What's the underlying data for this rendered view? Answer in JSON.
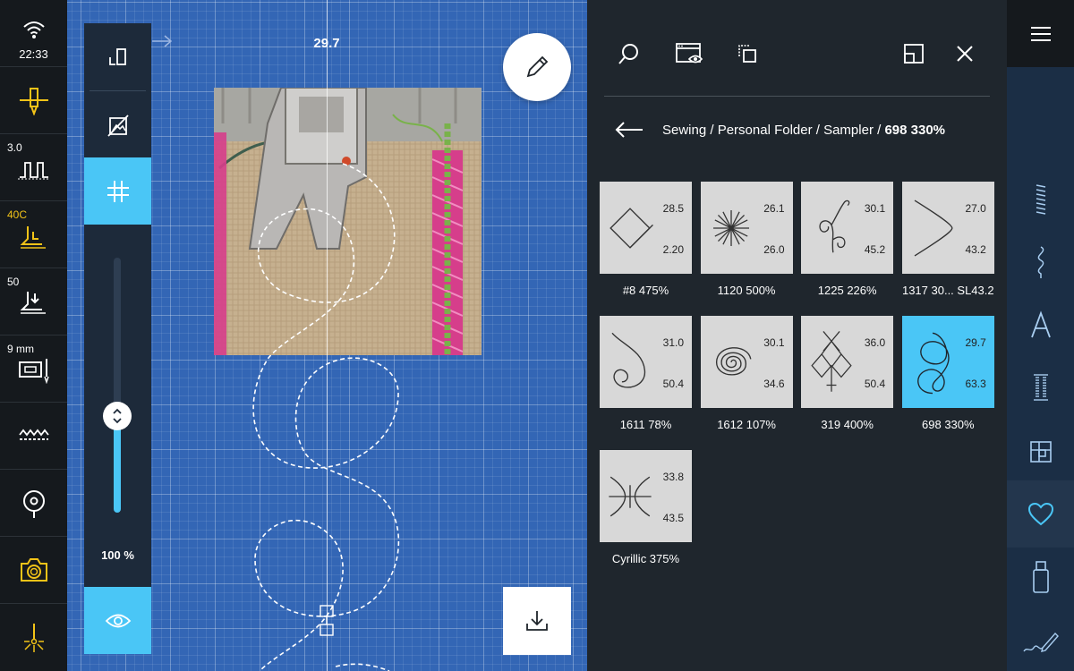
{
  "status": {
    "time": "22:33",
    "stitch_width": "3.0",
    "tension": "40C",
    "presser_foot_pressure": "50",
    "hoop_size": "9 mm"
  },
  "canvas": {
    "measurement": "29.7",
    "zoom_percent": "100 %",
    "zoom_level": 0.38
  },
  "breadcrumb": {
    "path": "Sewing / Personal Folder / Sampler / ",
    "current": "698 330%"
  },
  "stitches": [
    {
      "name": "#8 475%",
      "width": "28.5",
      "height": "2.20",
      "icon": "diamond-loop",
      "selected": false
    },
    {
      "name": "1120 500%",
      "width": "26.1",
      "height": "26.0",
      "icon": "star-burst",
      "selected": false
    },
    {
      "name": "1225 226%",
      "width": "30.1",
      "height": "45.2",
      "icon": "curl-vine",
      "selected": false
    },
    {
      "name": "1317 30... SL43.2",
      "width": "27.0",
      "height": "43.2",
      "icon": "chevron-curve",
      "selected": false
    },
    {
      "name": "1611 78%",
      "width": "31.0",
      "height": "50.4",
      "icon": "hook-spiral",
      "selected": false
    },
    {
      "name": "1612 107%",
      "width": "30.1",
      "height": "34.6",
      "icon": "spiral",
      "selected": false
    },
    {
      "name": "319 400%",
      "width": "36.0",
      "height": "50.4",
      "icon": "diamond-cross",
      "selected": false
    },
    {
      "name": "698 330%",
      "width": "29.7",
      "height": "63.3",
      "icon": "double-loop",
      "selected": true
    },
    {
      "name": "Cyrillic 375%",
      "width": "33.8",
      "height": "43.5",
      "icon": "cross-arc",
      "selected": false
    }
  ],
  "colors": {
    "accent": "#4ac6f6",
    "warning_yellow": "#f2c318",
    "canvas_blue": "#3366b5"
  }
}
